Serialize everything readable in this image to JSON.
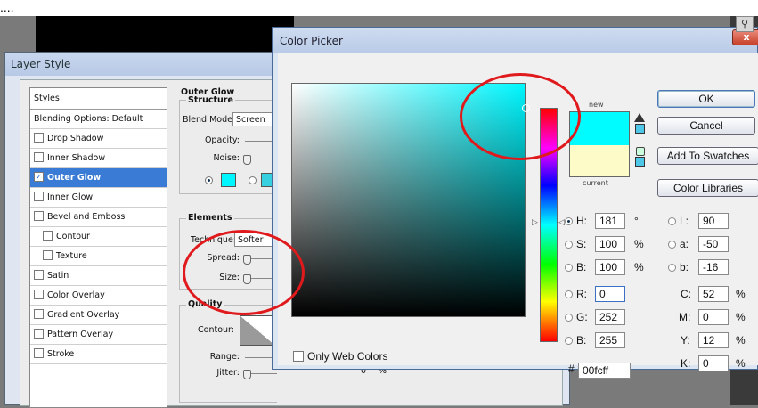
{
  "caption": {
    "text": "...."
  },
  "layer_style": {
    "title": "Layer Style",
    "styles_header": "Styles",
    "styles": [
      {
        "label": "Blending Options: Default",
        "checkbox": false,
        "indent": false,
        "checked": false,
        "selected": false
      },
      {
        "label": "Drop Shadow",
        "checkbox": true,
        "indent": false,
        "checked": false,
        "selected": false
      },
      {
        "label": "Inner Shadow",
        "checkbox": true,
        "indent": false,
        "checked": false,
        "selected": false
      },
      {
        "label": "Outer Glow",
        "checkbox": true,
        "indent": false,
        "checked": true,
        "selected": true
      },
      {
        "label": "Inner Glow",
        "checkbox": true,
        "indent": false,
        "checked": false,
        "selected": false
      },
      {
        "label": "Bevel and Emboss",
        "checkbox": true,
        "indent": false,
        "checked": false,
        "selected": false
      },
      {
        "label": "Contour",
        "checkbox": true,
        "indent": true,
        "checked": false,
        "selected": false
      },
      {
        "label": "Texture",
        "checkbox": true,
        "indent": true,
        "checked": false,
        "selected": false
      },
      {
        "label": "Satin",
        "checkbox": true,
        "indent": false,
        "checked": false,
        "selected": false
      },
      {
        "label": "Color Overlay",
        "checkbox": true,
        "indent": false,
        "checked": false,
        "selected": false
      },
      {
        "label": "Gradient Overlay",
        "checkbox": true,
        "indent": false,
        "checked": false,
        "selected": false
      },
      {
        "label": "Pattern Overlay",
        "checkbox": true,
        "indent": false,
        "checked": false,
        "selected": false
      },
      {
        "label": "Stroke",
        "checkbox": true,
        "indent": false,
        "checked": false,
        "selected": false
      }
    ],
    "outer_glow_title": "Outer Glow",
    "structure_title": "Structure",
    "blend_mode_label": "Blend Mode:",
    "blend_mode_value": "Screen",
    "opacity_label": "Opacity:",
    "noise_label": "Noise:",
    "elements_title": "Elements",
    "technique_label": "Technique:",
    "technique_value": "Softer",
    "spread_label": "Spread:",
    "size_label": "Size:",
    "quality_title": "Quality",
    "contour_label": "Contour:",
    "range_label": "Range:",
    "jitter_label": "Jitter:",
    "jitter_value": "0",
    "jitter_unit": "%",
    "glow_color": "#00f7ff"
  },
  "color_picker": {
    "title": "Color Picker",
    "close_label": "x",
    "new_label": "new",
    "current_label": "current",
    "new_color": "#00fcff",
    "current_color": "#fdfcc8",
    "buttons": {
      "ok": "OK",
      "cancel": "Cancel",
      "add_to_swatches": "Add To Swatches",
      "color_libraries": "Color Libraries"
    },
    "only_web_colors": "Only Web Colors",
    "hsb": {
      "h_label": "H:",
      "h_value": "181",
      "h_unit": "°",
      "s_label": "S:",
      "s_value": "100",
      "s_unit": "%",
      "b_label": "B:",
      "b_value": "100",
      "b_unit": "%"
    },
    "rgb": {
      "r_label": "R:",
      "r_value": "0",
      "g_label": "G:",
      "g_value": "252",
      "b_label": "B:",
      "b_value": "255"
    },
    "lab": {
      "l_label": "L:",
      "l_value": "90",
      "a_label": "a:",
      "a_value": "-50",
      "b_label": "b:",
      "b_value": "-16"
    },
    "cmyk": {
      "c_label": "C:",
      "c_value": "52",
      "m_label": "M:",
      "m_value": "0",
      "y_label": "Y:",
      "y_value": "12",
      "k_label": "K:",
      "k_value": "0",
      "unit": "%"
    },
    "hex_label": "#",
    "hex_value": "00fcff"
  },
  "annotation_color": "#e0191c"
}
